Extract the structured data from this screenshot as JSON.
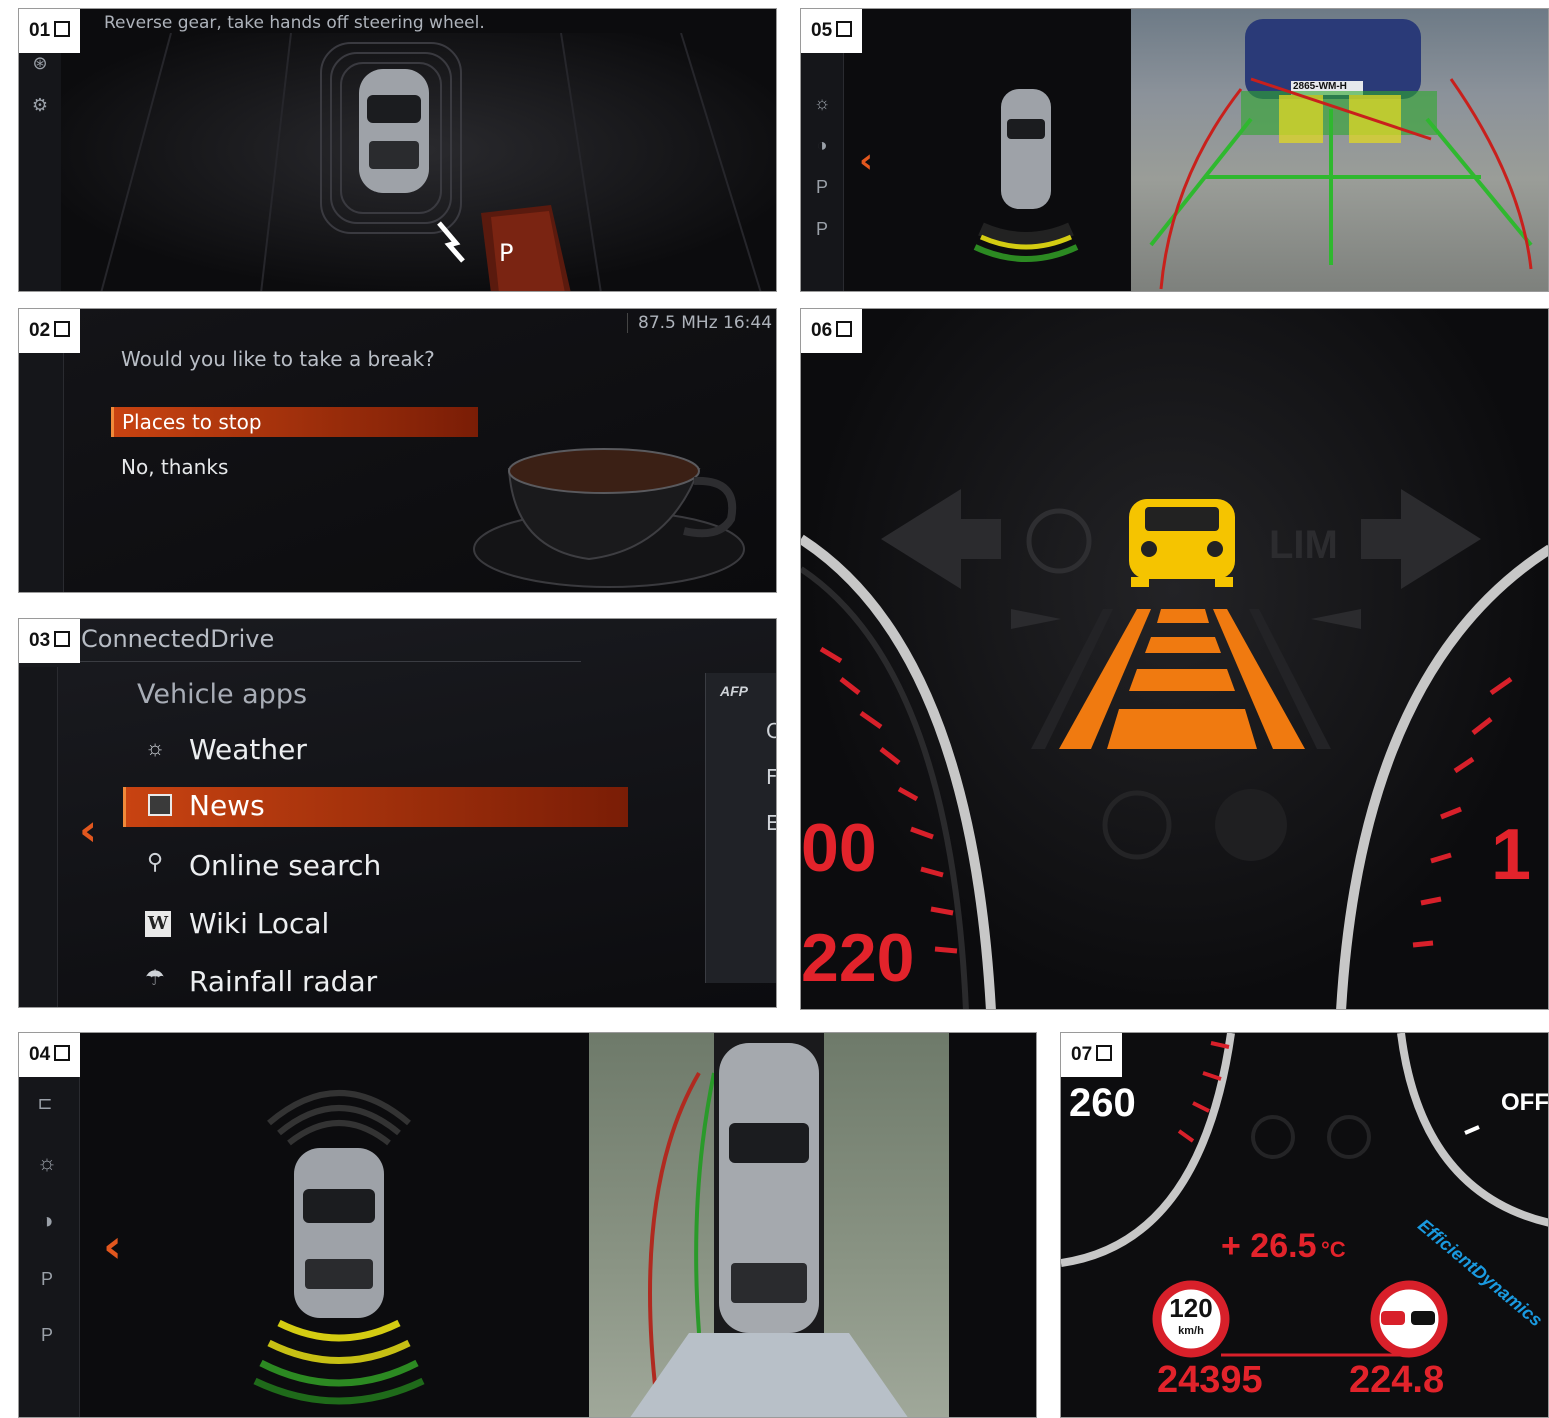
{
  "panels": {
    "p01": {
      "num": "01",
      "message": "Reverse gear, take hands off steering wheel.",
      "gear": "P"
    },
    "p02": {
      "num": "02",
      "status": "87.5 MHz  16:44",
      "question": "Would you like to take a break?",
      "options": [
        "Places to stop",
        "No, thanks"
      ],
      "selected": 0
    },
    "p03": {
      "num": "03",
      "title": "ConnectedDrive",
      "section": "Vehicle apps",
      "items": [
        {
          "label": "Weather",
          "icon": "weather-icon"
        },
        {
          "label": "News",
          "icon": "news-icon"
        },
        {
          "label": "Online search",
          "icon": "online-search-icon"
        },
        {
          "label": "Wiki Local",
          "icon": "wiki-icon"
        },
        {
          "label": "Rainfall radar",
          "icon": "rainfall-radar-icon"
        }
      ],
      "selected": 1,
      "side_logo": "AFP",
      "side_letters": [
        "C",
        "F",
        "E"
      ]
    },
    "p04": {
      "num": "04"
    },
    "p05": {
      "num": "05",
      "plate": "2865-WM-H"
    },
    "p06": {
      "num": "06",
      "lim": "LIM",
      "speed_labels": [
        "00",
        "220"
      ],
      "rpm_label": "1"
    },
    "p07": {
      "num": "07",
      "speed_label": "260",
      "off_label": "OFF",
      "temp": "+ 26.5",
      "temp_unit": "°C",
      "limit_value": "120",
      "limit_unit": "km/h",
      "odometer": "24395",
      "trip": "224.8",
      "brand": "EfficientDynamics"
    }
  },
  "colors": {
    "accent": "#e2571e",
    "warning": "#f5c400",
    "lane": "#f07a10",
    "red": "#d8202a"
  }
}
